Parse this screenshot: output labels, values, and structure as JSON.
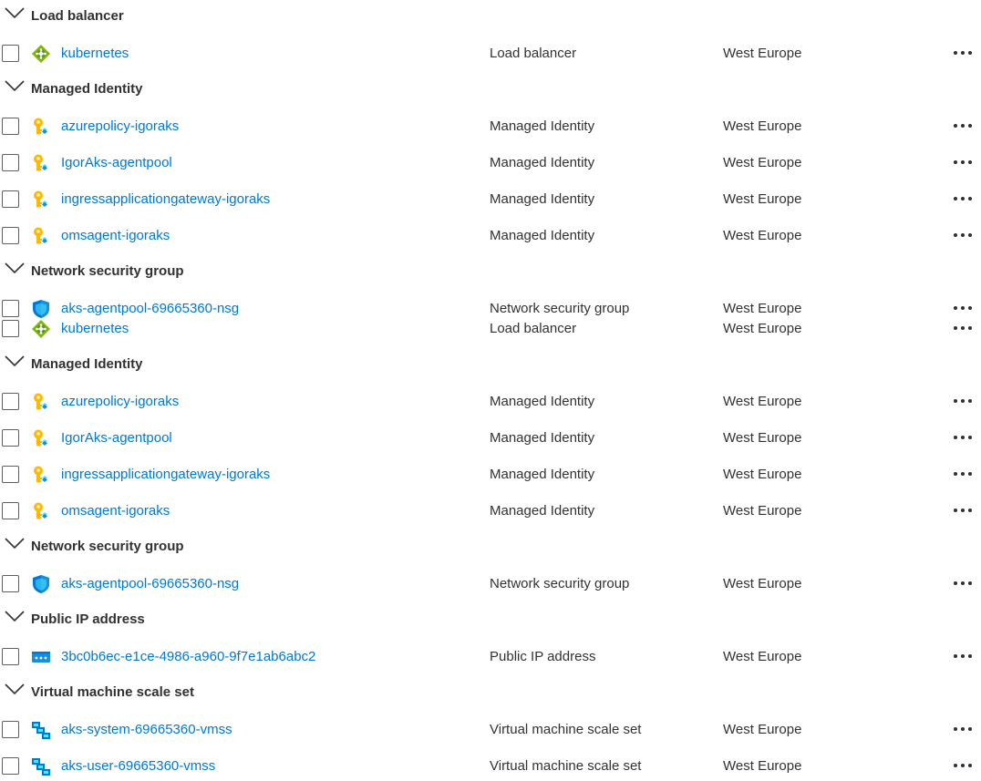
{
  "sections": [
    {
      "title": "Load balancer",
      "items": [
        {
          "name": "kubernetes",
          "type": "Load balancer",
          "location": "West Europe",
          "icon": "load-balancer-icon"
        }
      ]
    },
    {
      "title": "Managed Identity",
      "items": [
        {
          "name": "azurepolicy-igoraks",
          "type": "Managed Identity",
          "location": "West Europe",
          "icon": "managed-identity-icon"
        },
        {
          "name": "IgorAks-agentpool",
          "type": "Managed Identity",
          "location": "West Europe",
          "icon": "managed-identity-icon"
        },
        {
          "name": "ingressapplicationgateway-igoraks",
          "type": "Managed Identity",
          "location": "West Europe",
          "icon": "managed-identity-icon"
        },
        {
          "name": "omsagent-igoraks",
          "type": "Managed Identity",
          "location": "West Europe",
          "icon": "managed-identity-icon"
        }
      ]
    },
    {
      "title": "Network security group",
      "items": [
        {
          "name": "aks-agentpool-69665360-nsg",
          "type": "Network security group",
          "location": "West Europe",
          "icon": "nsg-shield-icon"
        },
        {
          "name": "kubernetes",
          "type": "Load balancer",
          "location": "West Europe",
          "icon": "load-balancer-icon"
        }
      ]
    },
    {
      "title": "Managed Identity",
      "items": [
        {
          "name": "azurepolicy-igoraks",
          "type": "Managed Identity",
          "location": "West Europe",
          "icon": "managed-identity-icon"
        },
        {
          "name": "IgorAks-agentpool",
          "type": "Managed Identity",
          "location": "West Europe",
          "icon": "managed-identity-icon"
        },
        {
          "name": "ingressapplicationgateway-igoraks",
          "type": "Managed Identity",
          "location": "West Europe",
          "icon": "managed-identity-icon"
        },
        {
          "name": "omsagent-igoraks",
          "type": "Managed Identity",
          "location": "West Europe",
          "icon": "managed-identity-icon"
        }
      ]
    },
    {
      "title": "Network security group",
      "items": [
        {
          "name": "aks-agentpool-69665360-nsg",
          "type": "Network security group",
          "location": "West Europe",
          "icon": "nsg-shield-icon"
        }
      ]
    },
    {
      "title": "Public IP address",
      "items": [
        {
          "name": "3bc0b6ec-e1ce-4986-a960-9f7e1ab6abc2",
          "type": "Public IP address",
          "location": "West Europe",
          "icon": "public-ip-icon"
        }
      ]
    },
    {
      "title": "Virtual machine scale set",
      "items": [
        {
          "name": "aks-system-69665360-vmss",
          "type": "Virtual machine scale set",
          "location": "West Europe",
          "icon": "vmss-icon"
        },
        {
          "name": "aks-user-69665360-vmss",
          "type": "Virtual machine scale set",
          "location": "West Europe",
          "icon": "vmss-icon"
        }
      ]
    }
  ],
  "colors": {
    "link": "#0078d4",
    "text": "#323130",
    "checkbox_border": "#605e5c"
  }
}
